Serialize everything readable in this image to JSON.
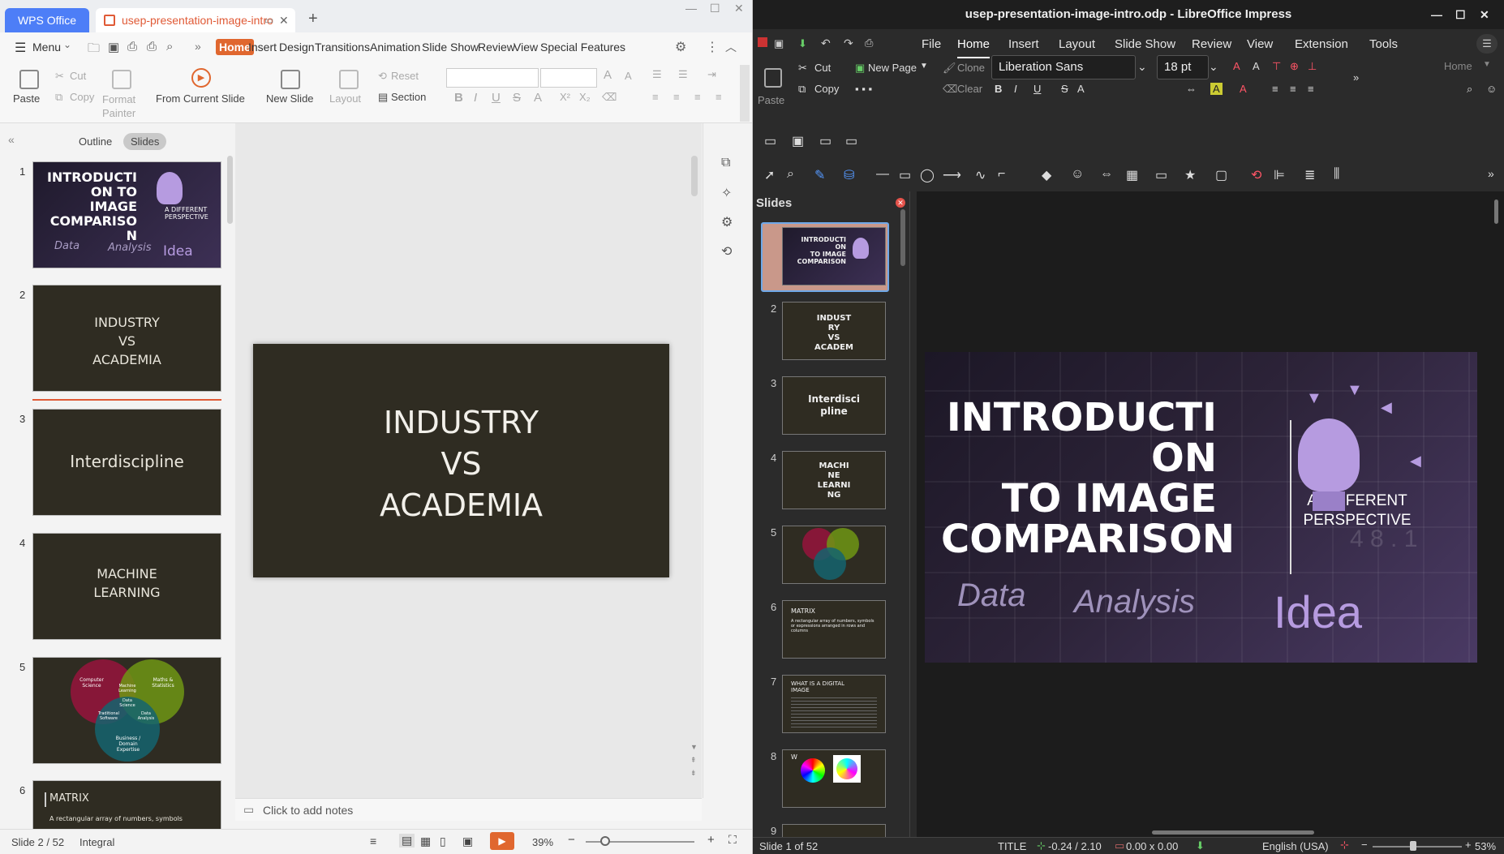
{
  "wps": {
    "brand_tab": "WPS Office",
    "doc_tab": "usep-presentation-image-intro",
    "new_tab_symbol": "+",
    "menu_label": "Menu",
    "more_symbol": "»",
    "tabs": [
      "Home",
      "Insert",
      "Design",
      "Transitions",
      "Animation",
      "Slide Show",
      "Review",
      "View",
      "Special Features"
    ],
    "ribbon": {
      "paste": "Paste",
      "cut": "Cut",
      "copy": "Copy",
      "format_painter": "Format Painter",
      "from_current_slide": "From Current Slide",
      "new_slide": "New Slide",
      "layout": "Layout",
      "reset": "Reset",
      "section": "Section"
    },
    "pane_tabs": [
      "Outline",
      "Slides"
    ],
    "slides": [
      {
        "num": "1",
        "title": "INTRODUCTI ON TO IMAGE COMPARISO N",
        "subtitle": "A DIFFERENT PERSPECTIVE",
        "words": [
          "Data",
          "Analysis",
          "Idea"
        ]
      },
      {
        "num": "2",
        "lines": [
          "INDUSTRY",
          "VS",
          "ACADEMIA"
        ]
      },
      {
        "num": "3",
        "lines": [
          "Interdiscipline"
        ]
      },
      {
        "num": "4",
        "lines": [
          "MACHINE",
          "LEARNING"
        ]
      },
      {
        "num": "5",
        "venn": [
          "Computer Science",
          "Maths & Statistics",
          "Machine Learning",
          "Data Science",
          "Traditional Software",
          "Data Analysis",
          "Business / Domain Expertise"
        ]
      },
      {
        "num": "6",
        "title": "MATRIX",
        "body": "A rectangular array of numbers, symbols"
      }
    ],
    "main_slide_lines": [
      "INDUSTRY",
      "VS",
      "ACADEMIA"
    ],
    "notes_placeholder": "Click to add notes",
    "status": {
      "slide": "Slide 2 / 52",
      "theme": "Integral",
      "zoom": "39%"
    }
  },
  "lo": {
    "window_title": "usep-presentation-image-intro.odp - LibreOffice Impress",
    "menus": [
      "File",
      "Home",
      "Insert",
      "Layout",
      "Slide Show",
      "Review",
      "View",
      "Extension",
      "Tools"
    ],
    "toolbar": {
      "cut": "Cut",
      "copy": "Copy",
      "paste": "Paste",
      "new_page": "New Page",
      "clone": "Clone",
      "clear": "Clear",
      "font_name": "Liberation Sans",
      "font_size": "18 pt",
      "home_dropdown": "Home"
    },
    "slides_panel_title": "Slides",
    "thumbs": [
      {
        "num": "1",
        "lines": [
          "INTRODUCTI",
          "ON",
          "TO IMAGE",
          "COMPARISON"
        ]
      },
      {
        "num": "2",
        "lines": [
          "INDUST",
          "RY",
          "VS",
          "ACADEM"
        ]
      },
      {
        "num": "3",
        "lines": [
          "Interdisci",
          "pline"
        ]
      },
      {
        "num": "4",
        "lines": [
          "MACHI",
          "NE",
          "LEARNI",
          "NG"
        ]
      },
      {
        "num": "5",
        "lines": []
      },
      {
        "num": "6",
        "title": "MATRIX",
        "body": "A rectangular array of numbers, symbols or expressions arranged in rows and columns"
      },
      {
        "num": "7",
        "title": "WHAT IS A DIGITAL IMAGE"
      },
      {
        "num": "8",
        "title": "W"
      },
      {
        "num": "9"
      }
    ],
    "big_slide": {
      "title_lines": [
        "INTRODUCTI",
        "ON",
        "TO IMAGE",
        "COMPARISON"
      ],
      "subtitle_lines": [
        "A DIFFERENT",
        "PERSPECTIVE"
      ],
      "words": [
        "Data",
        "Analysis",
        "Idea"
      ],
      "digits": "4 8 . 1"
    },
    "status": {
      "slide": "Slide 1 of 52",
      "selection": "TITLE",
      "position": "-0.24 / 2.10",
      "size": "0.00 x 0.00",
      "language": "English (USA)",
      "zoom": "53%"
    }
  },
  "colors": {
    "wps_accent": "#e0672f",
    "wps_blue": "#4d7ef7",
    "slide_bg": "#2f2c22",
    "lo_bg": "#2b2b2b",
    "purple": "#b69be0"
  }
}
